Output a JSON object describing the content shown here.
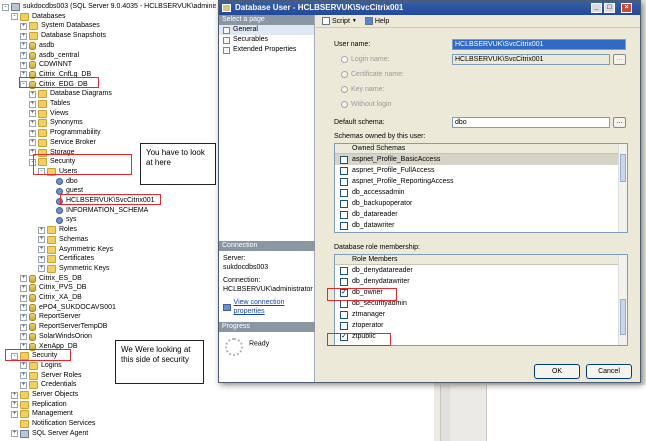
{
  "tree": {
    "nodes": [
      {
        "label": "sukdocdbs003 (SQL Server 9.0.4035 - HCLBSERVUK\\administrator)",
        "depth": 0,
        "expander": "-",
        "icon": "server"
      },
      {
        "label": "Databases",
        "depth": 1,
        "expander": "-",
        "icon": "folder"
      },
      {
        "label": "System Databases",
        "depth": 2,
        "expander": "+",
        "icon": "folder"
      },
      {
        "label": "Database Snapshots",
        "depth": 2,
        "expander": "+",
        "icon": "folder"
      },
      {
        "label": "asdb",
        "depth": 2,
        "expander": "+",
        "icon": "db"
      },
      {
        "label": "asdb_central",
        "depth": 2,
        "expander": "+",
        "icon": "db"
      },
      {
        "label": "CDWINNT",
        "depth": 2,
        "expander": "+",
        "icon": "db"
      },
      {
        "label": "Citrix_CnfLg_DB",
        "depth": 2,
        "expander": "+",
        "icon": "db"
      },
      {
        "label": "Citrix_EDG_DB",
        "depth": 2,
        "expander": "-",
        "icon": "db"
      },
      {
        "label": "Database Diagrams",
        "depth": 3,
        "expander": "+",
        "icon": "folder"
      },
      {
        "label": "Tables",
        "depth": 3,
        "expander": "+",
        "icon": "folder"
      },
      {
        "label": "Views",
        "depth": 3,
        "expander": "+",
        "icon": "folder"
      },
      {
        "label": "Synonyms",
        "depth": 3,
        "expander": "+",
        "icon": "folder"
      },
      {
        "label": "Programmability",
        "depth": 3,
        "expander": "+",
        "icon": "folder"
      },
      {
        "label": "Service Broker",
        "depth": 3,
        "expander": "+",
        "icon": "folder"
      },
      {
        "label": "Storage",
        "depth": 3,
        "expander": "+",
        "icon": "folder"
      },
      {
        "label": "Security",
        "depth": 3,
        "expander": "-",
        "icon": "folder"
      },
      {
        "label": "Users",
        "depth": 4,
        "expander": "-",
        "icon": "folder"
      },
      {
        "label": "dbo",
        "depth": 5,
        "expander": "",
        "icon": "user"
      },
      {
        "label": "guest",
        "depth": 5,
        "expander": "",
        "icon": "user"
      },
      {
        "label": "HCLBSERVUK\\SvcCitrix001",
        "depth": 5,
        "expander": "",
        "icon": "user"
      },
      {
        "label": "INFORMATION_SCHEMA",
        "depth": 5,
        "expander": "",
        "icon": "user"
      },
      {
        "label": "sys",
        "depth": 5,
        "expander": "",
        "icon": "user"
      },
      {
        "label": "Roles",
        "depth": 4,
        "expander": "+",
        "icon": "folder"
      },
      {
        "label": "Schemas",
        "depth": 4,
        "expander": "+",
        "icon": "folder"
      },
      {
        "label": "Asymmetric Keys",
        "depth": 4,
        "expander": "+",
        "icon": "folder"
      },
      {
        "label": "Certificates",
        "depth": 4,
        "expander": "+",
        "icon": "folder"
      },
      {
        "label": "Symmetric Keys",
        "depth": 4,
        "expander": "+",
        "icon": "folder"
      },
      {
        "label": "Citrix_ES_DB",
        "depth": 2,
        "expander": "+",
        "icon": "db"
      },
      {
        "label": "Citrix_PVS_DB",
        "depth": 2,
        "expander": "+",
        "icon": "db"
      },
      {
        "label": "Citrix_XA_DB",
        "depth": 2,
        "expander": "+",
        "icon": "db"
      },
      {
        "label": "ePO4_SUKDOCAVS001",
        "depth": 2,
        "expander": "+",
        "icon": "db"
      },
      {
        "label": "ReportServer",
        "depth": 2,
        "expander": "+",
        "icon": "db"
      },
      {
        "label": "ReportServerTempDB",
        "depth": 2,
        "expander": "+",
        "icon": "db"
      },
      {
        "label": "SolarWindsOrion",
        "depth": 2,
        "expander": "+",
        "icon": "db"
      },
      {
        "label": "XenApp_DB",
        "depth": 2,
        "expander": "+",
        "icon": "db"
      },
      {
        "label": "Security",
        "depth": 1,
        "expander": "-",
        "icon": "folder"
      },
      {
        "label": "Logins",
        "depth": 2,
        "expander": "+",
        "icon": "folder"
      },
      {
        "label": "Server Roles",
        "depth": 2,
        "expander": "+",
        "icon": "folder"
      },
      {
        "label": "Credentials",
        "depth": 2,
        "expander": "+",
        "icon": "folder"
      },
      {
        "label": "Server Objects",
        "depth": 1,
        "expander": "+",
        "icon": "folder"
      },
      {
        "label": "Replication",
        "depth": 1,
        "expander": "+",
        "icon": "folder"
      },
      {
        "label": "Management",
        "depth": 1,
        "expander": "+",
        "icon": "folder"
      },
      {
        "label": "Notification Services",
        "depth": 1,
        "expander": "",
        "icon": "folder"
      },
      {
        "label": "SQL Server Agent",
        "depth": 1,
        "expander": "+",
        "icon": "server"
      }
    ]
  },
  "annotations": {
    "look_here": "You have to look at here",
    "security_side": "We Were looking at this side of security",
    "accent_color": "#e8262b"
  },
  "dialog": {
    "title": "Database User - HCLBSERVUK\\SvcCitrix001",
    "select_page_header": "Select a page",
    "pages": [
      "General",
      "Securables",
      "Extended Properties"
    ],
    "connection_header": "Connection",
    "server_label": "Server:",
    "server_value": "sukdocdbs003",
    "connection_label": "Connection:",
    "connection_value": "HCLBSERVUK\\administrator",
    "view_connection_link": "View connection properties",
    "progress_header": "Progress",
    "progress_status": "Ready",
    "toolbar": {
      "script": "Script",
      "help": "Help"
    },
    "user_name_label": "User name:",
    "user_name_value": "HCLBSERVUK\\SvcCitrix001",
    "login_name_label": "Login name:",
    "login_name_value": "HCLBSERVUK\\SvcCitrix001",
    "certificate_name_label": "Certificate name:",
    "key_name_label": "Key name:",
    "without_login_label": "Without login",
    "default_schema_label": "Default schema:",
    "default_schema_value": "dbo",
    "schemas_owned_label": "Schemas owned by this user:",
    "owned_schemas_header": "Owned Schemas",
    "owned_schemas": [
      {
        "name": "aspnet_Profile_BasicAccess",
        "checked": false,
        "selected": true
      },
      {
        "name": "aspnet_Profile_FullAccess",
        "checked": false,
        "selected": false
      },
      {
        "name": "aspnet_Profile_ReportingAccess",
        "checked": false,
        "selected": false
      },
      {
        "name": "db_accessadmin",
        "checked": false,
        "selected": false
      },
      {
        "name": "db_backupoperator",
        "checked": false,
        "selected": false
      },
      {
        "name": "db_datareader",
        "checked": false,
        "selected": false
      },
      {
        "name": "db_datawriter",
        "checked": false,
        "selected": false
      }
    ],
    "role_membership_label": "Database role membership:",
    "role_members_header": "Role Members",
    "role_members": [
      {
        "name": "db_denydatareader",
        "checked": false
      },
      {
        "name": "db_denydatawriter",
        "checked": false
      },
      {
        "name": "db_owner",
        "checked": true
      },
      {
        "name": "db_securityadmin",
        "checked": false
      },
      {
        "name": "ztmanager",
        "checked": false
      },
      {
        "name": "ztoperator",
        "checked": false
      },
      {
        "name": "ztpublic",
        "checked": true
      }
    ],
    "ok_label": "OK",
    "cancel_label": "Cancel",
    "ellipsis": "...",
    "check_mark": "✓"
  }
}
